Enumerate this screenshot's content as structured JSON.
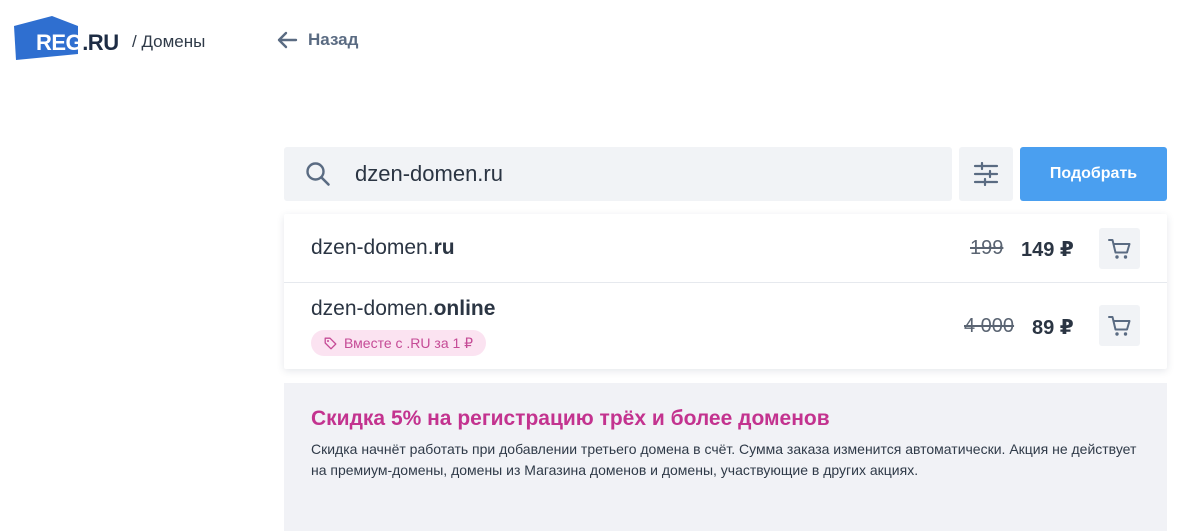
{
  "colors": {
    "accent": "#4a9ff0",
    "logo_blue": "#2f6fd0",
    "promo_title": "#c3338f",
    "badge_bg": "#fbe3f1",
    "badge_text": "#c54b96"
  },
  "header": {
    "logo": {
      "reg": "REG",
      "ru": ".RU"
    },
    "breadcrumb": "/ Домены",
    "back_label": "Назад",
    "back_icon": "arrow-left-icon"
  },
  "search": {
    "icon": "search-icon",
    "value": "dzen-domen.ru",
    "filter_icon": "sliders-icon",
    "submit_label": "Подобрать"
  },
  "results": [
    {
      "name": "dzen-domen.",
      "tld": "ru",
      "old_price": "199",
      "price": "149 ₽",
      "cart_icon": "cart-icon"
    },
    {
      "name": "dzen-domen.",
      "tld": "online",
      "badge": "Вместе с .RU за 1 ₽",
      "badge_icon": "tag-icon",
      "old_price": "4 000",
      "price": "89 ₽",
      "cart_icon": "cart-icon"
    }
  ],
  "promo": {
    "title": "Скидка 5% на регистрацию трёх и более доменов",
    "text": "Скидка начнёт работать при добавлении третьего домена в счёт. Сумма заказа изменится автоматически. Акция не действует на премиум-домены, домены из Магазина доменов и домены, участвующие в других акциях."
  }
}
